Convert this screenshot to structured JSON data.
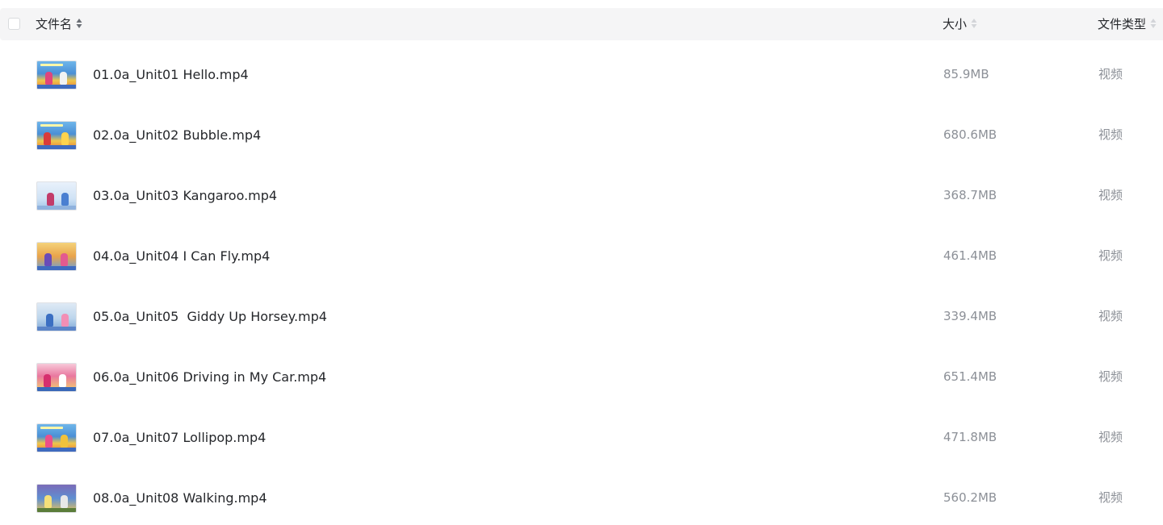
{
  "header": {
    "name_label": "文件名",
    "size_label": "大小",
    "type_label": "文件类型"
  },
  "colors": {
    "header_bg": "#f5f5f6",
    "text_primary": "#25272b",
    "text_secondary": "#8c9097"
  },
  "files": [
    {
      "name": "01.0a_Unit01 Hello.mp4",
      "size": "85.9MB",
      "type": "视频",
      "icon": "video-thumbnail"
    },
    {
      "name": "02.0a_Unit02 Bubble.mp4",
      "size": "680.6MB",
      "type": "视频",
      "icon": "video-thumbnail"
    },
    {
      "name": "03.0a_Unit03 Kangaroo.mp4",
      "size": "368.7MB",
      "type": "视频",
      "icon": "video-thumbnail"
    },
    {
      "name": "04.0a_Unit04 I Can Fly.mp4",
      "size": "461.4MB",
      "type": "视频",
      "icon": "video-thumbnail"
    },
    {
      "name": "05.0a_Unit05  Giddy Up Horsey.mp4",
      "size": "339.4MB",
      "type": "视频",
      "icon": "video-thumbnail"
    },
    {
      "name": "06.0a_Unit06 Driving in My Car.mp4",
      "size": "651.4MB",
      "type": "视频",
      "icon": "video-thumbnail"
    },
    {
      "name": "07.0a_Unit07 Lollipop.mp4",
      "size": "471.8MB",
      "type": "视频",
      "icon": "video-thumbnail"
    },
    {
      "name": "08.0a_Unit08 Walking.mp4",
      "size": "560.2MB",
      "type": "视频",
      "icon": "video-thumbnail"
    }
  ]
}
